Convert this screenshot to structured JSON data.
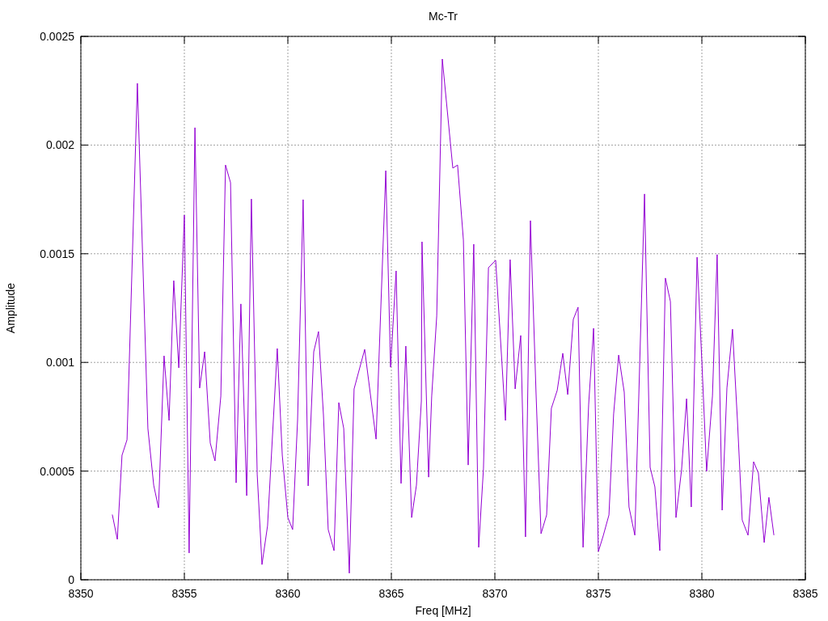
{
  "chart_data": {
    "type": "line",
    "title": "Mc-Tr",
    "xlabel": "Freq [MHz]",
    "ylabel": "Amplitude",
    "x": [
      8351.52,
      8351.76,
      8351.99,
      8352.23,
      8352.73,
      8353.24,
      8353.52,
      8353.75,
      8354.02,
      8354.26,
      8354.49,
      8354.73,
      8355.0,
      8355.23,
      8355.51,
      8355.74,
      8355.98,
      8356.25,
      8356.48,
      8356.76,
      8356.99,
      8357.23,
      8357.5,
      8357.73,
      8358.01,
      8358.24,
      8358.52,
      8358.75,
      8359.02,
      8359.49,
      8359.73,
      8360.0,
      8360.23,
      8360.47,
      8360.74,
      8360.98,
      8361.25,
      8361.48,
      8361.72,
      8361.95,
      8362.23,
      8362.46,
      8362.7,
      8362.97,
      8363.2,
      8363.71,
      8364.26,
      8364.73,
      8364.96,
      8365.23,
      8365.47,
      8365.7,
      8365.98,
      8366.21,
      8366.45,
      8366.48,
      8366.8,
      8366.95,
      8367.19,
      8367.46,
      8367.97,
      8368.2,
      8368.48,
      8368.71,
      8368.98,
      8369.22,
      8369.45,
      8369.69,
      8370.04,
      8370.51,
      8370.74,
      8370.98,
      8371.25,
      8371.48,
      8371.72,
      8371.99,
      8372.23,
      8372.5,
      8372.73,
      8373.01,
      8373.28,
      8373.52,
      8373.79,
      8374.02,
      8374.26,
      8374.53,
      8374.77,
      8375.0,
      8375.23,
      8375.51,
      8375.74,
      8375.98,
      8376.25,
      8376.48,
      8376.76,
      8377.23,
      8377.5,
      8377.73,
      8377.97,
      8378.24,
      8378.48,
      8378.75,
      8379.02,
      8379.26,
      8379.49,
      8379.77,
      8380.0,
      8380.23,
      8380.51,
      8380.74,
      8380.98,
      8381.21,
      8381.48,
      8381.72,
      8381.95,
      8382.23,
      8382.5,
      8382.73,
      8383.01,
      8383.24,
      8383.48
    ],
    "series": [
      {
        "color": "#9400d3",
        "values": [
          0.0003,
          0.000186,
          0.000573,
          0.000644,
          0.002284,
          0.000696,
          0.000435,
          0.000331,
          0.00103,
          0.000733,
          0.001376,
          0.000975,
          0.001678,
          0.000123,
          0.00208,
          0.000882,
          0.001049,
          0.000629,
          0.000547,
          0.000845,
          0.001908,
          0.001827,
          0.000446,
          0.001269,
          0.000387,
          0.001752,
          0.000484,
          7e-05,
          0.000249,
          0.001064,
          0.000573,
          0.000286,
          0.000231,
          0.000733,
          0.001749,
          0.000432,
          0.001049,
          0.001142,
          0.000759,
          0.000231,
          0.000134,
          0.000815,
          0.000696,
          3e-05,
          0.000878,
          0.00106,
          0.000647,
          0.001882,
          0.000978,
          0.001421,
          0.000443,
          0.001075,
          0.000286,
          0.000435,
          0.000822,
          0.001555,
          0.000472,
          0.000845,
          0.001213,
          0.002396,
          0.001894,
          0.001908,
          0.001563,
          0.000528,
          0.001544,
          0.000149,
          0.00051,
          0.001436,
          0.00147,
          0.000733,
          0.001473,
          0.000878,
          0.001124,
          0.000197,
          0.001652,
          0.000863,
          0.000212,
          0.000298,
          0.000789,
          0.000871,
          0.001042,
          0.000852,
          0.001198,
          0.001254,
          0.000149,
          0.000807,
          0.001157,
          0.00013,
          0.000201,
          0.000298,
          0.000763,
          0.001034,
          0.000863,
          0.000335,
          0.000205,
          0.001775,
          0.000517,
          0.000428,
          0.000134,
          0.001388,
          0.00128,
          0.000286,
          0.000506,
          0.000833,
          0.000335,
          0.001484,
          0.001004,
          0.000499,
          0.000845,
          0.001496,
          0.00032,
          0.000882,
          0.001153,
          0.000733,
          0.000275,
          0.000205,
          0.000543,
          0.000491,
          0.000171,
          0.000379,
          0.000205
        ]
      }
    ],
    "grid": true,
    "xlim": [
      8350,
      8385
    ],
    "ylim": [
      0,
      0.0025
    ],
    "xticks": [
      8350,
      8355,
      8360,
      8365,
      8370,
      8375,
      8380,
      8385
    ],
    "yticks": [
      {
        "value": 0,
        "label": "0"
      },
      {
        "value": 0.0005,
        "label": "0.0005"
      },
      {
        "value": 0.001,
        "label": "0.001"
      },
      {
        "value": 0.0015,
        "label": "0.0015"
      },
      {
        "value": 0.002,
        "label": "0.002"
      },
      {
        "value": 0.0025,
        "label": "0.0025"
      }
    ]
  }
}
